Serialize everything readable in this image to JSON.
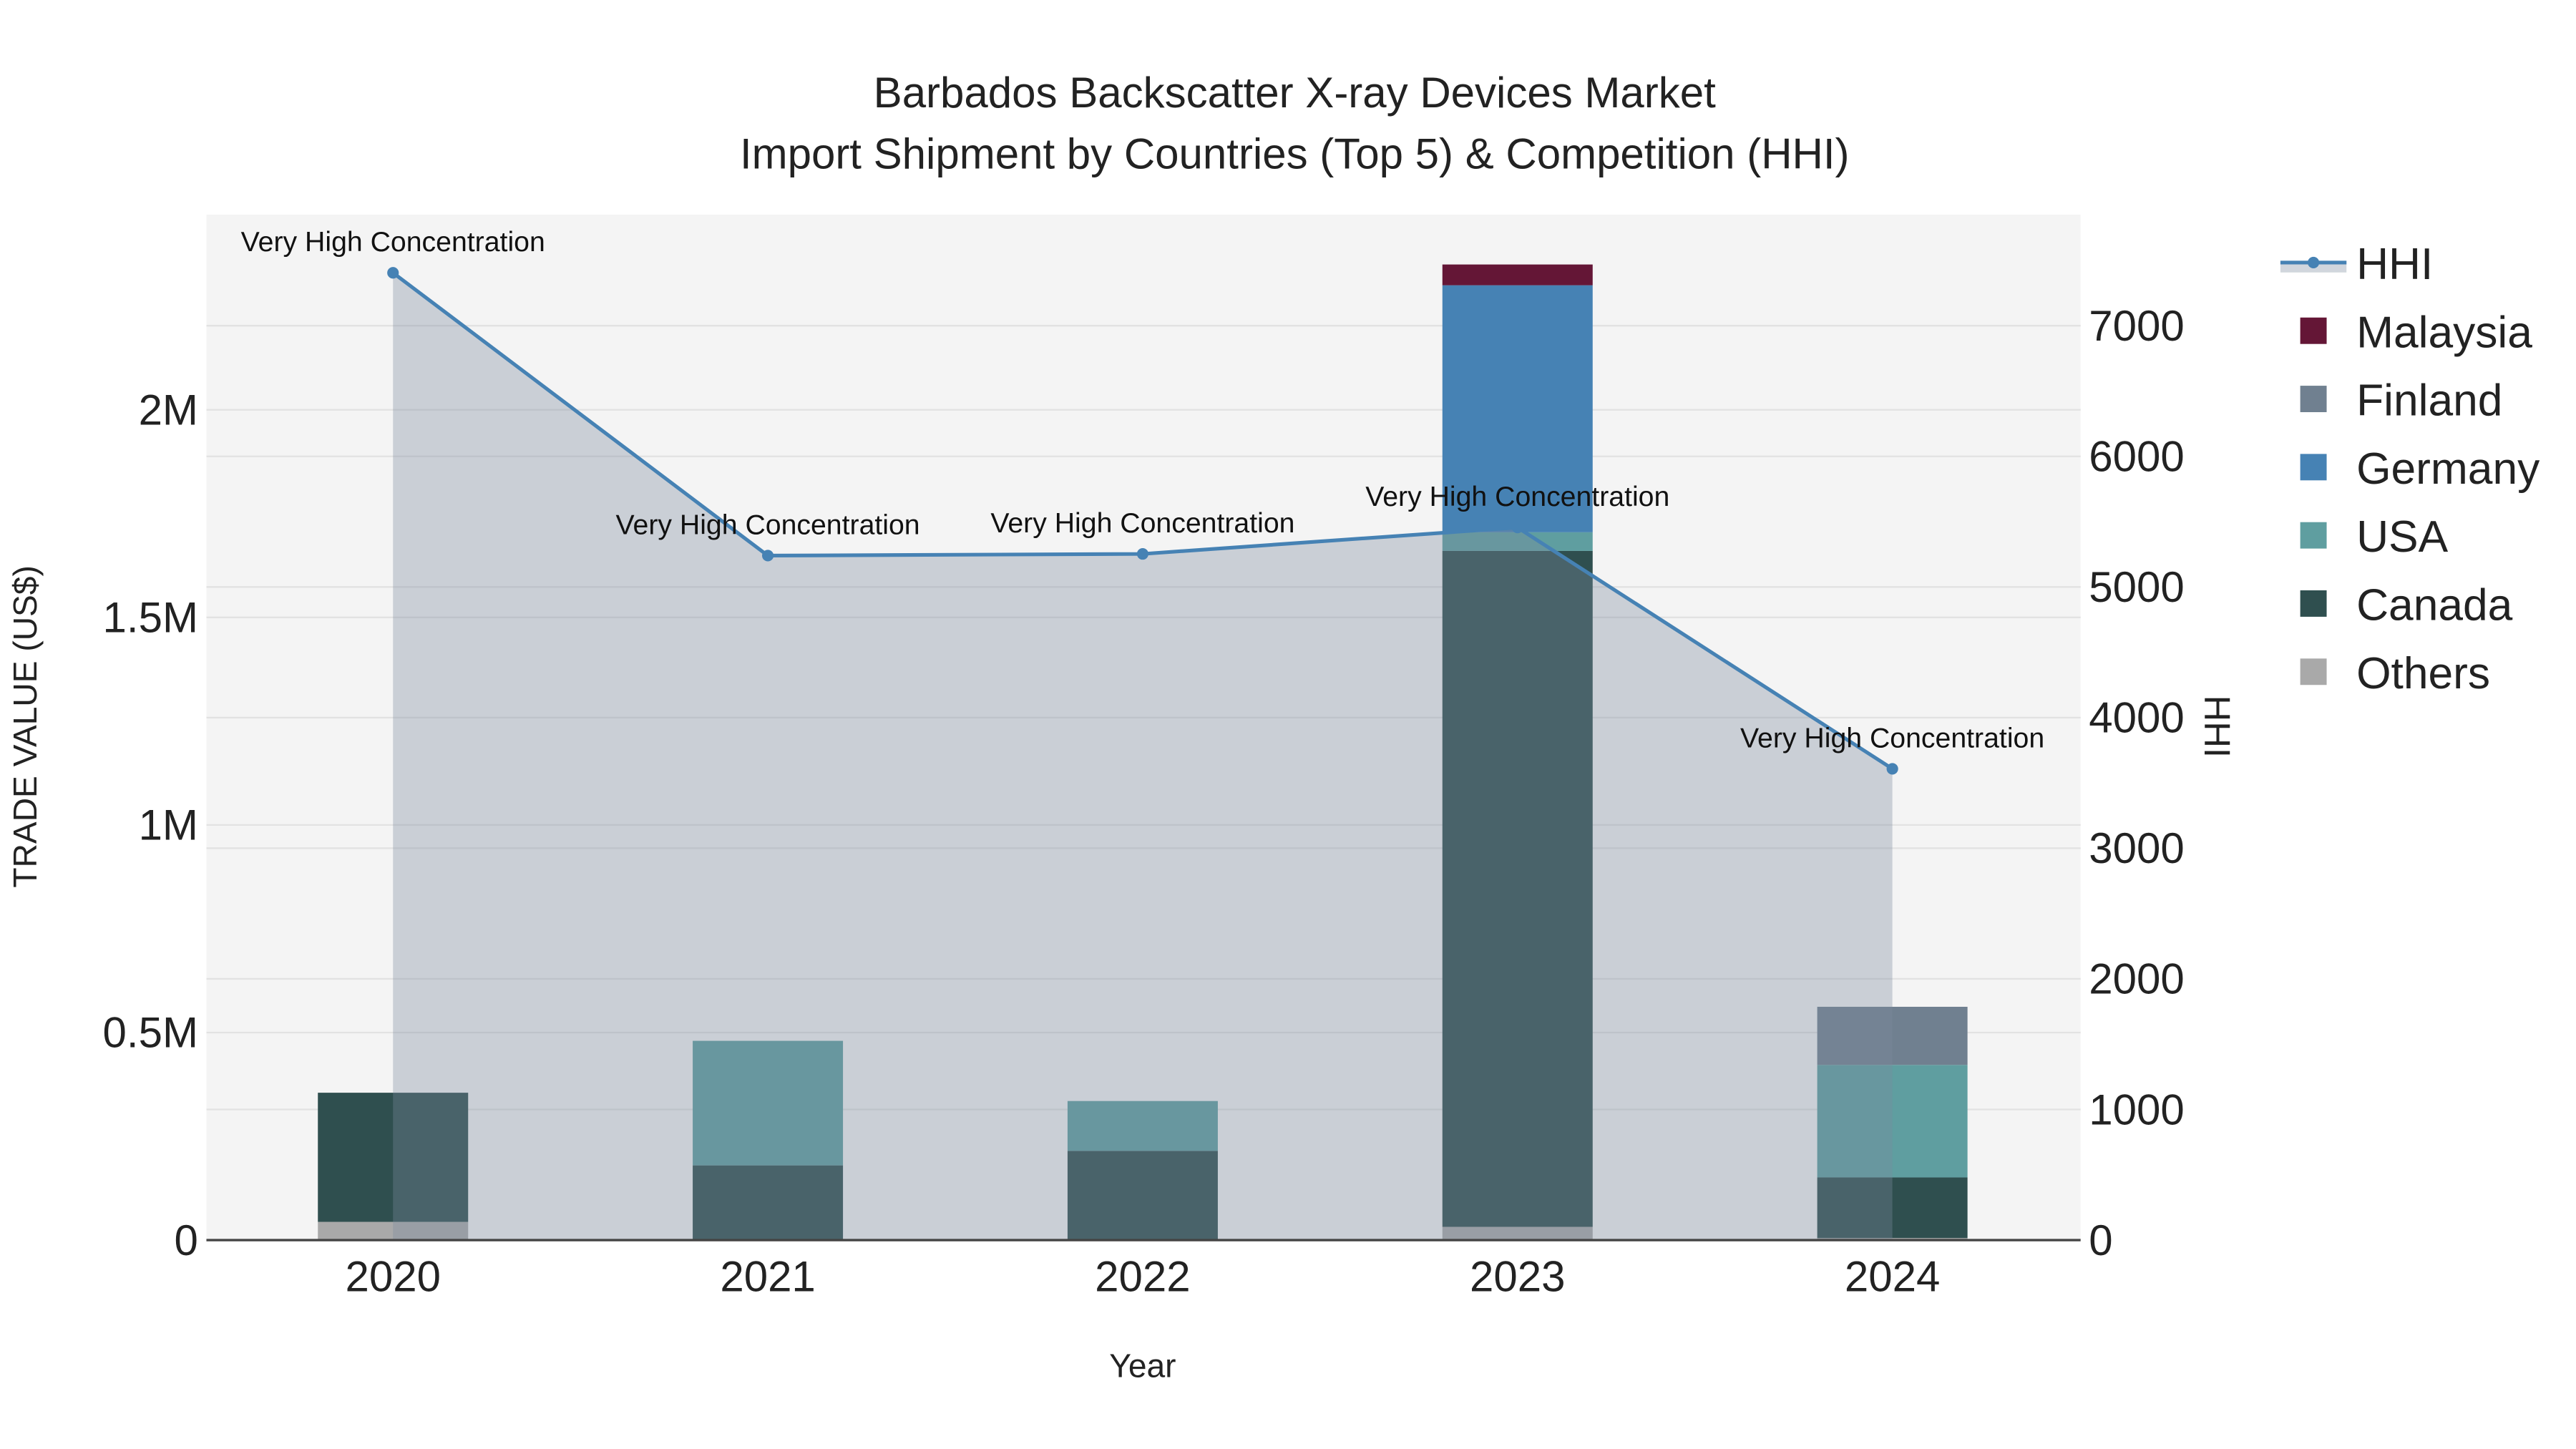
{
  "chart_data": {
    "type": "bar",
    "title_line1": "Barbados Backscatter X-ray Devices Market",
    "title_line2": "Import Shipment by Countries (Top 5) & Competition (HHI)",
    "xlabel": "Year",
    "ylabel": "TRADE VALUE (US$)",
    "y2label": "HHI",
    "categories": [
      "2020",
      "2021",
      "2022",
      "2023",
      "2024"
    ],
    "ylim": [
      0,
      2.47
    ],
    "y_unit": "million US$",
    "yticks": [
      {
        "v": 0,
        "label": "0"
      },
      {
        "v": 0.5,
        "label": "0.5M"
      },
      {
        "v": 1,
        "label": "1M"
      },
      {
        "v": 1.5,
        "label": "1.5M"
      },
      {
        "v": 2,
        "label": "2M"
      }
    ],
    "y2lim": [
      0,
      7850
    ],
    "y2ticks": [
      0,
      1000,
      2000,
      3000,
      4000,
      5000,
      6000,
      7000
    ],
    "series": [
      {
        "name": "Others",
        "color": "#A9A9A9",
        "values": [
          0.044,
          0,
          0,
          0.032,
          0.005
        ]
      },
      {
        "name": "Canada",
        "color": "#2F4F4F",
        "values": [
          0.311,
          0.18,
          0.215,
          1.628,
          0.146
        ]
      },
      {
        "name": "USA",
        "color": "#5F9EA0",
        "values": [
          0,
          0.3,
          0.12,
          0.045,
          0.271
        ]
      },
      {
        "name": "Germany",
        "color": "#4682B4",
        "values": [
          0,
          0,
          0,
          0.595,
          0
        ]
      },
      {
        "name": "Finland",
        "color": "#708090",
        "values": [
          0,
          0,
          0,
          0,
          0.14
        ]
      },
      {
        "name": "Malaysia",
        "color": "#641636",
        "values": [
          0,
          0,
          0,
          0.05,
          0
        ]
      }
    ],
    "hhi": {
      "name": "HHI",
      "color": "#4682B4",
      "values": [
        7405,
        5240,
        5253,
        5455,
        3608
      ],
      "labels": [
        "Very High Concentration",
        "Very High Concentration",
        "Very High Concentration",
        "Very High Concentration",
        "Very High Concentration"
      ]
    },
    "legend": [
      "HHI",
      "Malaysia",
      "Finland",
      "Germany",
      "USA",
      "Canada",
      "Others"
    ],
    "legend_placement": "right",
    "grid": true
  }
}
